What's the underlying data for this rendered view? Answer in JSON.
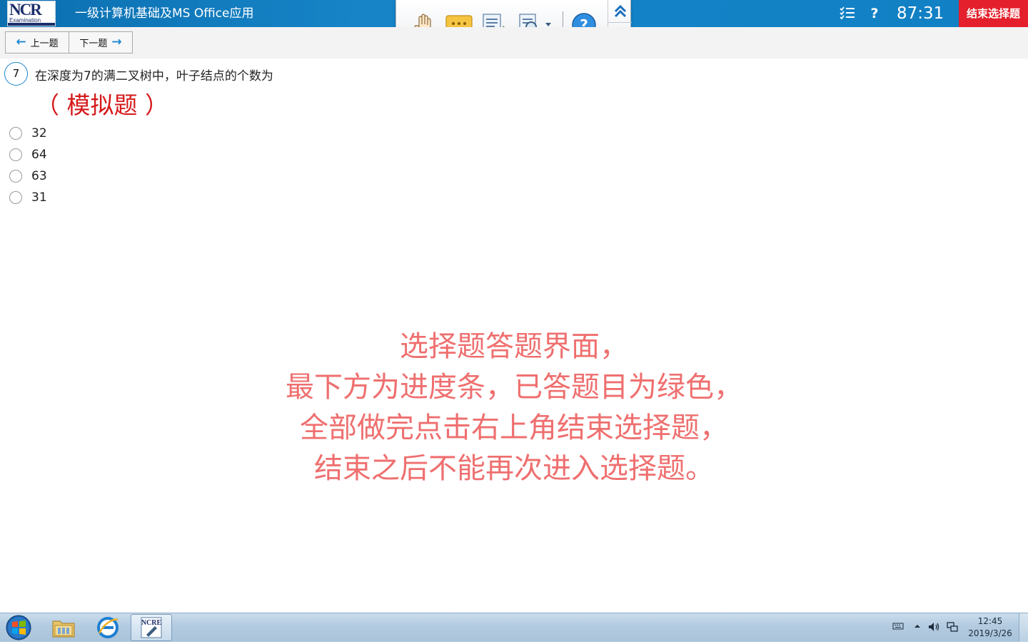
{
  "header": {
    "logo_text": "NCR",
    "logo_sub": "Examination",
    "title": "一级计算机基础及MS Office应用",
    "timer": "87:31",
    "end_button": "结束选择题",
    "list_icon": "checklist-icon",
    "help_icon": "question-mark-icon"
  },
  "float_toolbar": {
    "buttons": [
      "hand-icon",
      "comment-bubble-icon",
      "document-export-icon",
      "zoom-document-icon",
      "help-circle-icon"
    ],
    "side": [
      "double-chevron-up-icon",
      "pin-icon"
    ]
  },
  "nav": {
    "prev_label": "上一题",
    "next_label": "下一题"
  },
  "question": {
    "number": "7",
    "text": "在深度为7的满二叉树中，叶子结点的个数为",
    "tag": "（ 模拟题 ）",
    "options": [
      "32",
      "64",
      "63",
      "31"
    ]
  },
  "annotation": {
    "lines": [
      "选择题答题界面，",
      "最下方为进度条，已答题目为绿色，",
      "全部做完点击右上角结束选择题，",
      "结束之后不能再次进入选择题。"
    ]
  },
  "taskbar": {
    "items": [
      "windows-start-icon",
      "file-explorer-icon",
      "internet-explorer-icon",
      "ncre-app-icon"
    ],
    "active_item_label": "NCRE",
    "clock_time": "12:45",
    "clock_date": "2019/3/26"
  },
  "colors": {
    "header_blue": "#1180c4",
    "end_red": "#e3202b",
    "tag_red": "#d5191b",
    "annotation_red": "#ef6f6f",
    "accent_blue": "#1a86d0"
  }
}
